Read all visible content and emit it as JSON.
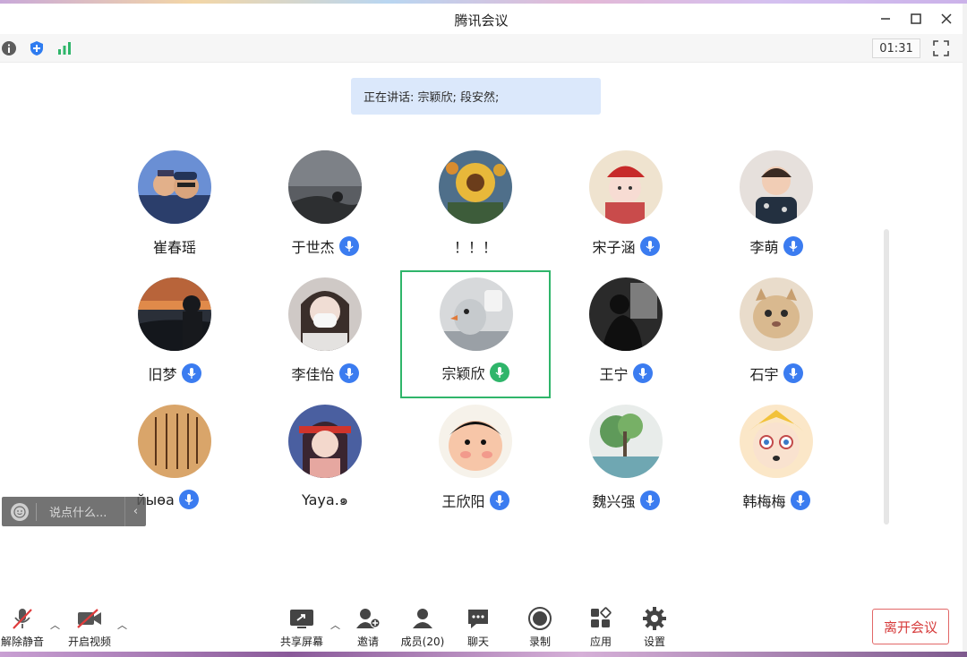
{
  "app": {
    "title": "腾讯会议"
  },
  "toolbar": {
    "timer": "01:31"
  },
  "banner": {
    "speaking": "正在讲话: 宗颖欣; 段安然;"
  },
  "participants": [
    {
      "name": "崔春瑶",
      "muted_icon": false,
      "talking": false
    },
    {
      "name": "于世杰",
      "muted_icon": true,
      "talking": false
    },
    {
      "name": "！！！",
      "muted_icon": false,
      "talking": false
    },
    {
      "name": "宋子涵",
      "muted_icon": true,
      "talking": false
    },
    {
      "name": "李萌",
      "muted_icon": true,
      "talking": false
    },
    {
      "name": "旧梦",
      "muted_icon": true,
      "talking": false
    },
    {
      "name": "李佳怡",
      "muted_icon": true,
      "talking": false
    },
    {
      "name": "宗颖欣",
      "muted_icon": true,
      "talking": true,
      "highlighted": true
    },
    {
      "name": "王宁",
      "muted_icon": true,
      "talking": false
    },
    {
      "name": "石宇",
      "muted_icon": true,
      "talking": false
    },
    {
      "name": "йыѳа",
      "muted_icon": true,
      "talking": false
    },
    {
      "name": "Yaya.๑",
      "muted_icon": false,
      "talking": false
    },
    {
      "name": "王欣阳",
      "muted_icon": true,
      "talking": false
    },
    {
      "name": "魏兴强",
      "muted_icon": true,
      "talking": false
    },
    {
      "name": "韩梅梅",
      "muted_icon": true,
      "talking": false
    }
  ],
  "chat": {
    "placeholder": "说点什么..."
  },
  "bottombar": {
    "unmute": "解除静音",
    "video": "开启视频",
    "share": "共享屏幕",
    "invite": "邀请",
    "members": "成员(20)",
    "chat": "聊天",
    "record": "录制",
    "apps": "应用",
    "settings": "设置",
    "leave": "离开会议"
  },
  "colors": {
    "accent": "#3b7cf0",
    "talking": "#2fb56a",
    "leave": "#d63b3b"
  }
}
